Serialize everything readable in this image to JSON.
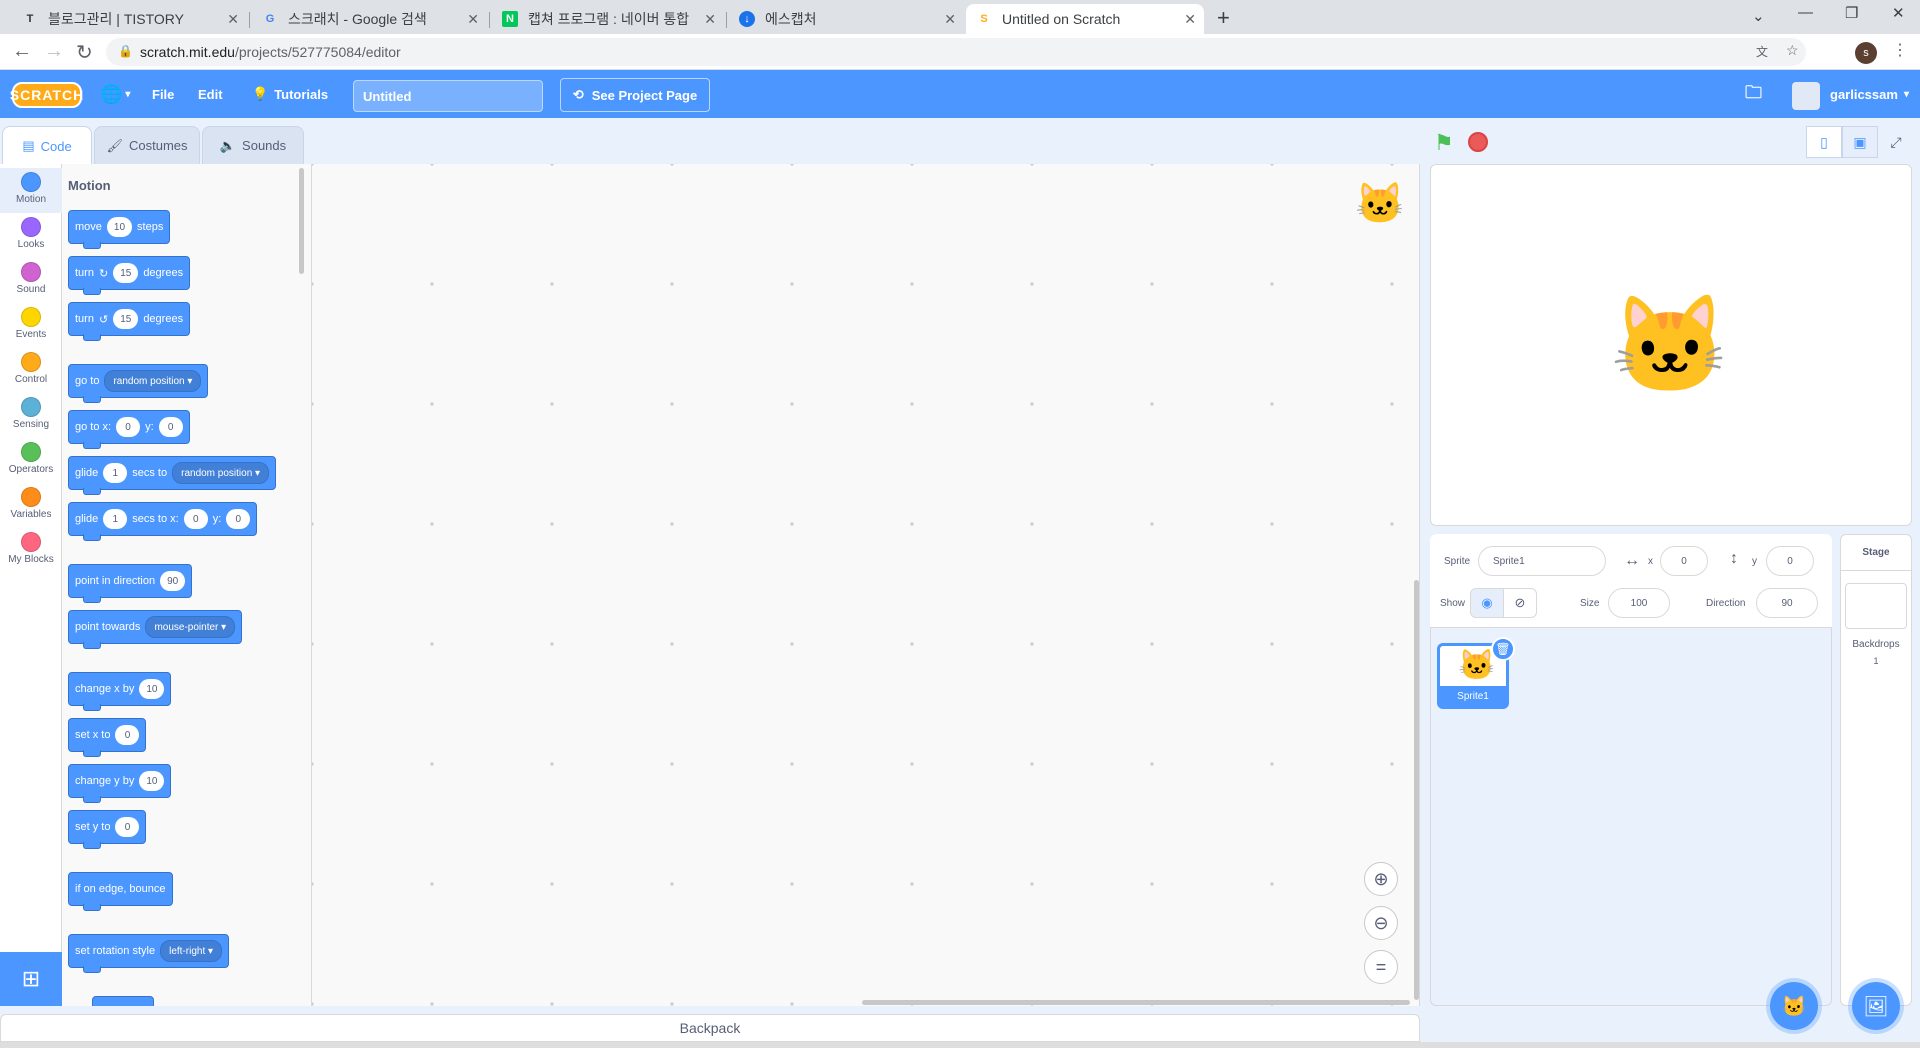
{
  "browser": {
    "tabs": [
      {
        "title": "블로그관리 | TISTORY",
        "fav": "T"
      },
      {
        "title": "스크래치 - Google 검색",
        "fav": "G"
      },
      {
        "title": "캡쳐 프로그램 : 네이버 통합",
        "fav": "N"
      },
      {
        "title": "에스캡처",
        "fav": "↓"
      },
      {
        "title": "Untitled on Scratch",
        "fav": "S"
      }
    ],
    "url_host": "scratch.mit.edu",
    "url_path": "/projects/527775084/editor",
    "profile_initial": "s"
  },
  "menubar": {
    "logo": "SCRATCH",
    "file": "File",
    "edit": "Edit",
    "tutorials": "Tutorials",
    "project_title": "Untitled",
    "see_project_page": "See Project Page",
    "username": "garlicssam"
  },
  "editor_tabs": {
    "code": "Code",
    "costumes": "Costumes",
    "sounds": "Sounds"
  },
  "categories": [
    {
      "label": "Motion",
      "color": "#4c97ff"
    },
    {
      "label": "Looks",
      "color": "#9966ff"
    },
    {
      "label": "Sound",
      "color": "#cf63cf"
    },
    {
      "label": "Events",
      "color": "#ffd500"
    },
    {
      "label": "Control",
      "color": "#ffab19"
    },
    {
      "label": "Sensing",
      "color": "#5cb1d6"
    },
    {
      "label": "Operators",
      "color": "#59c059"
    },
    {
      "label": "Variables",
      "color": "#ff8c1a"
    },
    {
      "label": "My Blocks",
      "color": "#ff6680"
    }
  ],
  "palette": {
    "title": "Motion",
    "move": {
      "a": "move",
      "n": "10",
      "b": "steps"
    },
    "turn_right": {
      "a": "turn",
      "n": "15",
      "b": "degrees"
    },
    "turn_left": {
      "a": "turn",
      "n": "15",
      "b": "degrees"
    },
    "go_to": {
      "a": "go to",
      "d": "random position"
    },
    "go_to_xy": {
      "a": "go to x:",
      "x": "0",
      "b": "y:",
      "y": "0"
    },
    "glide_to": {
      "a": "glide",
      "n": "1",
      "b": "secs to",
      "d": "random position"
    },
    "glide_xy": {
      "a": "glide",
      "n": "1",
      "b": "secs to x:",
      "x": "0",
      "c": "y:",
      "y": "0"
    },
    "point_direction": {
      "a": "point in direction",
      "n": "90"
    },
    "point_towards": {
      "a": "point towards",
      "d": "mouse-pointer"
    },
    "change_x": {
      "a": "change x by",
      "n": "10"
    },
    "set_x": {
      "a": "set x to",
      "n": "0"
    },
    "change_y": {
      "a": "change y by",
      "n": "10"
    },
    "set_y": {
      "a": "set y to",
      "n": "0"
    },
    "bounce": {
      "a": "if on edge, bounce"
    },
    "rotation_style": {
      "a": "set rotation style",
      "d": "left-right"
    }
  },
  "backpack": "Backpack",
  "sprite_info": {
    "sprite_label": "Sprite",
    "sprite_name": "Sprite1",
    "x_label": "x",
    "x_value": "0",
    "y_label": "y",
    "y_value": "0",
    "show_label": "Show",
    "size_label": "Size",
    "size_value": "100",
    "direction_label": "Direction",
    "direction_value": "90"
  },
  "sprite_list": [
    {
      "name": "Sprite1"
    }
  ],
  "stage_target": {
    "header": "Stage",
    "backdrops_label": "Backdrops",
    "backdrops_count": "1"
  }
}
